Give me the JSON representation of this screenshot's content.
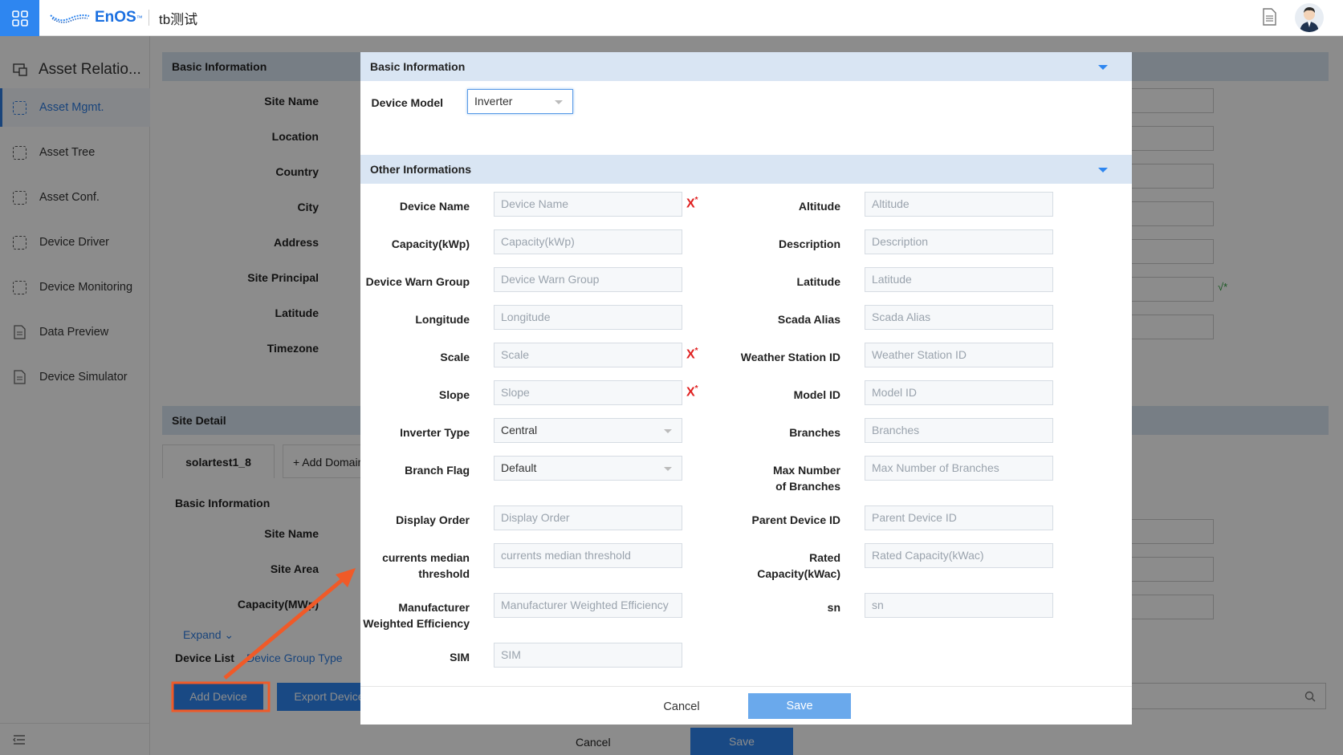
{
  "topbar": {
    "logo_text": "EnOS",
    "logo_tm": "™",
    "app_name": "tb测试"
  },
  "sidebar": {
    "title": "Asset Relatio...",
    "items": [
      {
        "label": "Asset Mgmt.",
        "active": true
      },
      {
        "label": "Asset Tree"
      },
      {
        "label": "Asset Conf."
      },
      {
        "label": "Device Driver"
      },
      {
        "label": "Device Monitoring"
      },
      {
        "label": "Data Preview"
      },
      {
        "label": "Device Simulator"
      }
    ]
  },
  "background": {
    "basic_info_header": "Basic Information",
    "labels": [
      "Site Name",
      "Location",
      "Country",
      "City",
      "Address",
      "Site Principal",
      "Latitude",
      "Timezone"
    ],
    "site_detail_header": "Site Detail",
    "tab_label": "solartest1_8",
    "add_domain": "+ Add Domain",
    "sub_basic_info": "Basic Information",
    "sub_labels": [
      "Site Name",
      "Site Area",
      "Capacity(MWp)"
    ],
    "expand": "Expand",
    "device_list": "Device List",
    "device_group_type": "Device Group Type",
    "add_device_button": "Add Device",
    "export_device_button": "Export Device",
    "cancel": "Cancel",
    "save": "Save",
    "check_mark": "√*"
  },
  "modal": {
    "basic_header": "Basic Information",
    "device_model_label": "Device Model",
    "device_model_value": "Inverter",
    "other_header": "Other Informations",
    "left_fields": [
      {
        "label": "Device Name",
        "placeholder": "Device Name",
        "required": true
      },
      {
        "label": "Capacity(kWp)",
        "placeholder": "Capacity(kWp)"
      },
      {
        "label": "Device Warn Group",
        "placeholder": "Device Warn Group"
      },
      {
        "label": "Longitude",
        "placeholder": "Longitude"
      },
      {
        "label": "Scale",
        "placeholder": "Scale",
        "required": true
      },
      {
        "label": "Slope",
        "placeholder": "Slope",
        "required": true
      },
      {
        "label": "Inverter Type",
        "value": "Central",
        "select": true
      },
      {
        "label": "Branch Flag",
        "value": "Default",
        "select": true
      },
      {
        "label": "Display Order",
        "placeholder": "Display Order"
      },
      {
        "label": "currents median threshold",
        "placeholder": "currents median threshold"
      },
      {
        "label": "Manufacturer Weighted Efficiency",
        "placeholder": "Manufacturer Weighted Efficiency"
      },
      {
        "label": "SIM",
        "placeholder": "SIM"
      }
    ],
    "right_fields": [
      {
        "label": "Altitude",
        "placeholder": "Altitude"
      },
      {
        "label": "Description",
        "placeholder": "Description"
      },
      {
        "label": "Latitude",
        "placeholder": "Latitude"
      },
      {
        "label": "Scada Alias",
        "placeholder": "Scada Alias"
      },
      {
        "label": "Weather Station ID",
        "placeholder": "Weather Station ID"
      },
      {
        "label": "Model ID",
        "placeholder": "Model ID"
      },
      {
        "label": "Branches",
        "placeholder": "Branches"
      },
      {
        "label": "Max Number of Branches",
        "placeholder": "Max Number of Branches"
      },
      {
        "label": "Parent Device ID",
        "placeholder": "Parent Device ID"
      },
      {
        "label": "Rated Capacity(kWac)",
        "placeholder": "Rated Capacity(kWac)"
      },
      {
        "label": "sn",
        "placeholder": "sn"
      }
    ],
    "required_mark": "X",
    "cancel_label": "Cancel",
    "save_label": "Save"
  },
  "colors": {
    "accent": "#2e86f0",
    "section_header": "#d9e5f3",
    "save_button": "#6aa9ec",
    "annotation": "#f05a28",
    "required": "#e02020"
  }
}
